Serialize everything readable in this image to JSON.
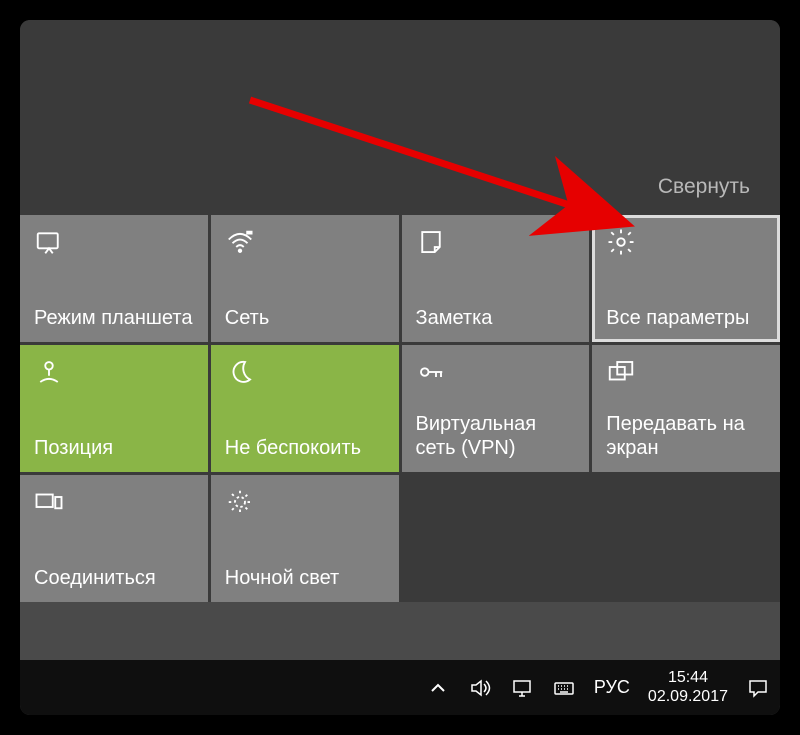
{
  "collapse_label": "Свернуть",
  "tiles": [
    {
      "id": "tablet-mode",
      "icon": "tablet",
      "label": "Режим планшета",
      "active": false,
      "highlighted": false
    },
    {
      "id": "network",
      "icon": "wifi",
      "label": "Сеть",
      "active": false,
      "highlighted": false
    },
    {
      "id": "note",
      "icon": "note",
      "label": "Заметка",
      "active": false,
      "highlighted": false
    },
    {
      "id": "all-settings",
      "icon": "gear",
      "label": "Все параметры",
      "active": false,
      "highlighted": true
    },
    {
      "id": "location",
      "icon": "location",
      "label": "Позиция",
      "active": true,
      "highlighted": false
    },
    {
      "id": "quiet-hours",
      "icon": "moon",
      "label": "Не беспокоить",
      "active": true,
      "highlighted": false
    },
    {
      "id": "vpn",
      "icon": "vpn",
      "label": "Виртуальная сеть (VPN)",
      "active": false,
      "highlighted": false
    },
    {
      "id": "project",
      "icon": "project",
      "label": "Передавать на экран",
      "active": false,
      "highlighted": false
    },
    {
      "id": "connect",
      "icon": "connect",
      "label": "Соединиться",
      "active": false,
      "highlighted": false
    },
    {
      "id": "night-light",
      "icon": "sun",
      "label": "Ночной свет",
      "active": false,
      "highlighted": false
    }
  ],
  "taskbar": {
    "language": "РУС",
    "time": "15:44",
    "date": "02.09.2017"
  },
  "colors": {
    "tile": "#808080",
    "tile_active": "#8ab547",
    "panel_bg": "#3a3a3a",
    "taskbar_bg": "#0f0f0f",
    "arrow": "#e60000"
  }
}
